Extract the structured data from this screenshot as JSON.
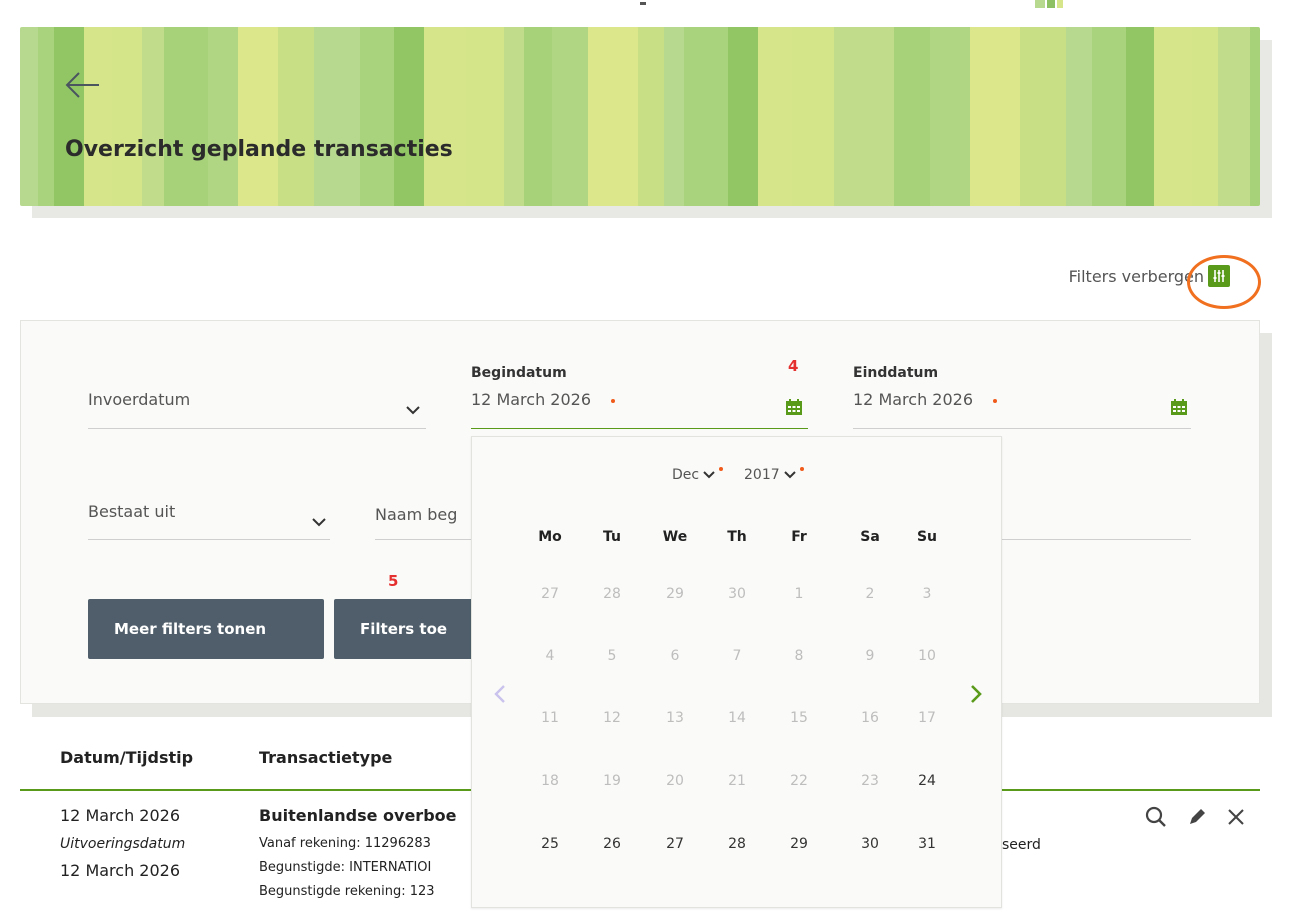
{
  "page": {
    "title": "Overzicht geplande transacties",
    "back_icon": "arrow-left-icon"
  },
  "colors": {
    "accent": "#5a9a1a",
    "button": "#4f5e6a",
    "required": "#f05a1a",
    "highlight_ring": "#f07020",
    "marker": "#e53030"
  },
  "filters_toggle": {
    "label": "Filters verbergen",
    "icon": "sliders-icon"
  },
  "annotations": {
    "marker_begin": "4",
    "marker_apply": "5"
  },
  "filters": {
    "date_type": {
      "value": "Invoerdatum"
    },
    "begin_date": {
      "label": "Begindatum",
      "value": "12 March 2026"
    },
    "end_date": {
      "label": "Einddatum",
      "value": "12 March 2026"
    },
    "consists_of": {
      "value": "Bestaat uit"
    },
    "beneficiary_name": {
      "placeholder": "Naam beg"
    },
    "more_filters_button": "Meer filters tonen",
    "apply_filters_button": "Filters toe"
  },
  "datepicker": {
    "month": "Dec",
    "year": "2017",
    "weekdays": [
      "Mo",
      "Tu",
      "We",
      "Th",
      "Fr",
      "Sa",
      "Su"
    ],
    "weeks": [
      [
        {
          "d": "27",
          "in": false
        },
        {
          "d": "28",
          "in": false
        },
        {
          "d": "29",
          "in": false
        },
        {
          "d": "30",
          "in": false
        },
        {
          "d": "1",
          "in": false
        },
        {
          "d": "2",
          "in": false
        },
        {
          "d": "3",
          "in": false
        }
      ],
      [
        {
          "d": "4",
          "in": false
        },
        {
          "d": "5",
          "in": false
        },
        {
          "d": "6",
          "in": false
        },
        {
          "d": "7",
          "in": false
        },
        {
          "d": "8",
          "in": false
        },
        {
          "d": "9",
          "in": false
        },
        {
          "d": "10",
          "in": false
        }
      ],
      [
        {
          "d": "11",
          "in": false
        },
        {
          "d": "12",
          "in": false
        },
        {
          "d": "13",
          "in": false
        },
        {
          "d": "14",
          "in": false
        },
        {
          "d": "15",
          "in": false
        },
        {
          "d": "16",
          "in": false
        },
        {
          "d": "17",
          "in": false
        }
      ],
      [
        {
          "d": "18",
          "in": false
        },
        {
          "d": "19",
          "in": false
        },
        {
          "d": "20",
          "in": false
        },
        {
          "d": "21",
          "in": false
        },
        {
          "d": "22",
          "in": false
        },
        {
          "d": "23",
          "in": false
        },
        {
          "d": "24",
          "in": true
        }
      ],
      [
        {
          "d": "25",
          "in": true
        },
        {
          "d": "26",
          "in": true
        },
        {
          "d": "27",
          "in": true
        },
        {
          "d": "28",
          "in": true
        },
        {
          "d": "29",
          "in": true
        },
        {
          "d": "30",
          "in": true
        },
        {
          "d": "31",
          "in": true
        }
      ]
    ]
  },
  "table": {
    "headers": {
      "datetime": "Datum/Tijdstip",
      "type": "Transactietype"
    },
    "row": {
      "date": "12 March 2026",
      "exec_label": "Uitvoeringsdatum",
      "exec_date": "12 March 2026",
      "type_title": "Buitenlandse overboe",
      "from_account": "Vanaf rekening: 11296283",
      "beneficiary": "Begunstigde: INTERNATIOI",
      "beneficiary_account": "Begunstigde rekening: 123",
      "status_fragment": "seerd",
      "actions": [
        "search-icon",
        "pencil-icon",
        "close-icon"
      ]
    }
  }
}
